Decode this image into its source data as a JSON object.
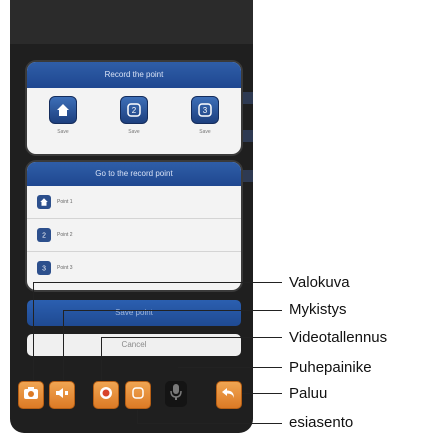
{
  "screen": {
    "background_title": "",
    "record_panel": {
      "title": "Record the point",
      "buttons": [
        {
          "icon": "home-icon",
          "label": "Save"
        },
        {
          "icon": "slot-2-icon",
          "label": "Save"
        },
        {
          "icon": "slot-3-icon",
          "label": "Save"
        }
      ]
    },
    "goto_panel": {
      "title": "Go to the record point",
      "items": [
        {
          "label": "Point 1"
        },
        {
          "label": "Point 2"
        },
        {
          "label": "Point 3"
        }
      ]
    },
    "save_button": "Save point",
    "cancel_button": "Cancel"
  },
  "toolbar": {
    "buttons": [
      {
        "icon": "camera-icon",
        "callout": "Valokuva"
      },
      {
        "icon": "speaker-mute-icon",
        "callout": "Mykistys"
      },
      {
        "icon": "record-icon",
        "callout": "Videotallennus"
      },
      {
        "icon": "preset-icon",
        "callout": "esiasento"
      },
      {
        "icon": "microphone-icon",
        "callout": "Puhepainike"
      },
      {
        "icon": "back-arrow-icon",
        "callout": "Paluu"
      }
    ]
  },
  "colors": {
    "toolbar_orange": "#e08a33",
    "panel_header_blue": "#2a58a4",
    "screen_background": "#1f1f1f"
  }
}
